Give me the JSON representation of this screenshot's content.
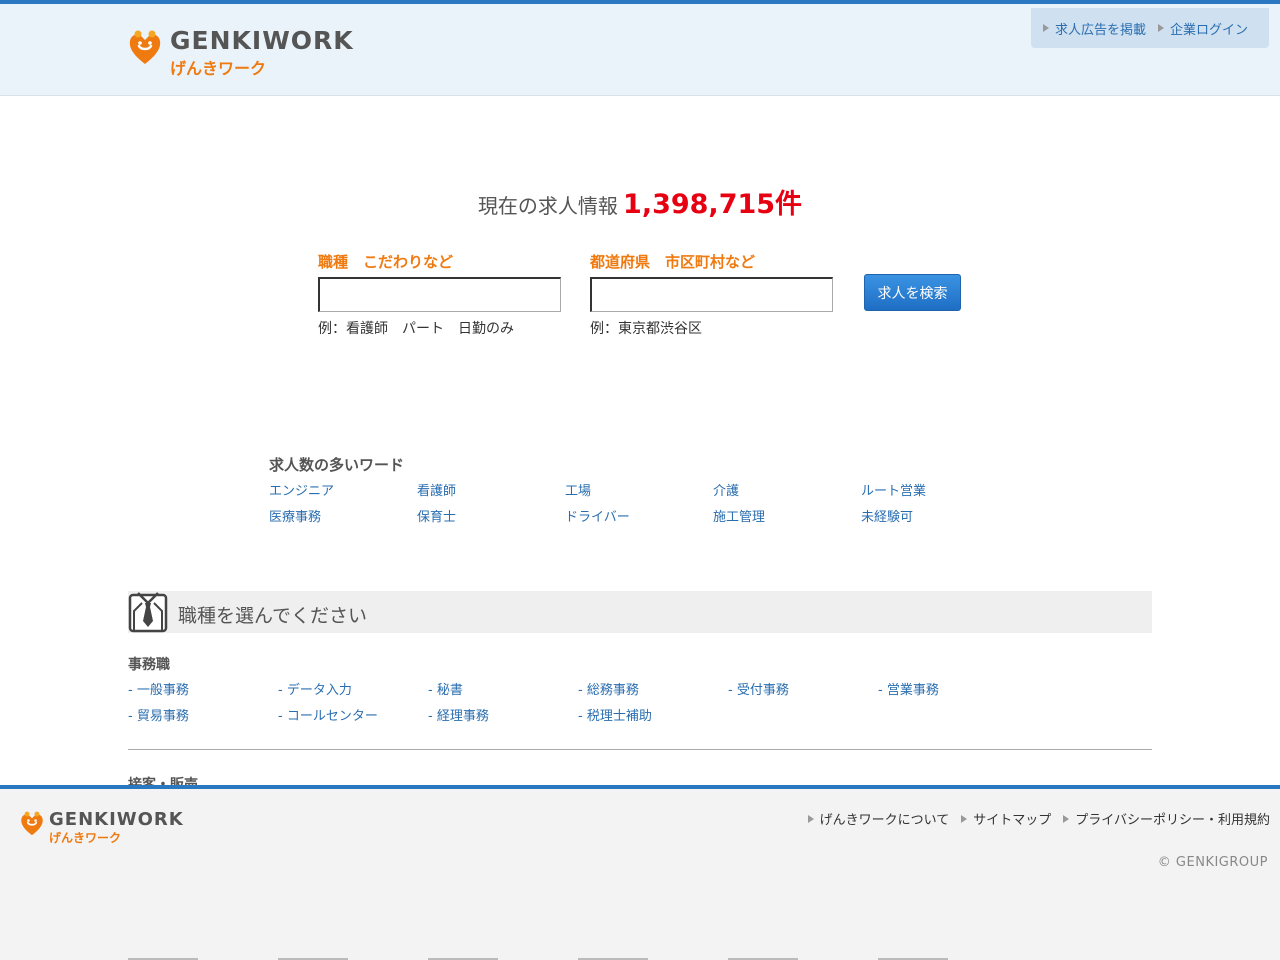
{
  "brand": {
    "name_en": "GENKIWORK",
    "name_ja": "げんきワーク",
    "colors": {
      "primary_blue": "#2a78c2",
      "orange": "#ef7a10",
      "count_red": "#e60012",
      "link_blue": "#2a6eb0"
    }
  },
  "header": {
    "links": [
      {
        "label": "求人広告を掲載",
        "icon": "triangle-right-icon"
      },
      {
        "label": "企業ログイン",
        "icon": "triangle-right-icon"
      }
    ]
  },
  "summary": {
    "label": "現在の求人情報",
    "count": "1,398,715件"
  },
  "search": {
    "job_field": {
      "label": "職種　こだわりなど",
      "value": "",
      "hint": "例：看護師　パート　日勤のみ"
    },
    "location_field": {
      "label": "都道府県　市区町村など",
      "value": "",
      "hint": "例：東京都渋谷区"
    },
    "button_label": "求人を検索"
  },
  "popular": {
    "title": "求人数の多いワード",
    "words": [
      "エンジニア",
      "看護師",
      "工場",
      "介護",
      "ルート営業",
      "医療事務",
      "保育士",
      "ドライバー",
      "施工管理",
      "未経験可"
    ]
  },
  "categories": {
    "title": "職種を選んでください",
    "icon": "suit-tie-icon",
    "groups": [
      {
        "title": "事務職",
        "items": [
          "- 一般事務",
          "- データ入力",
          "- 秘書",
          "- 総務事務",
          "- 受付事務",
          "- 営業事務",
          "- 貿易事務",
          "- コールセンター",
          "- 経理事務",
          "- 税理士補助"
        ]
      },
      {
        "title": "接客・販売"
      }
    ]
  },
  "footer": {
    "links": [
      {
        "label": "げんきワークについて"
      },
      {
        "label": "サイトマップ"
      },
      {
        "label": "プライバシーポリシー・利用規約"
      }
    ],
    "copyright": "© GENKIGROUP"
  }
}
